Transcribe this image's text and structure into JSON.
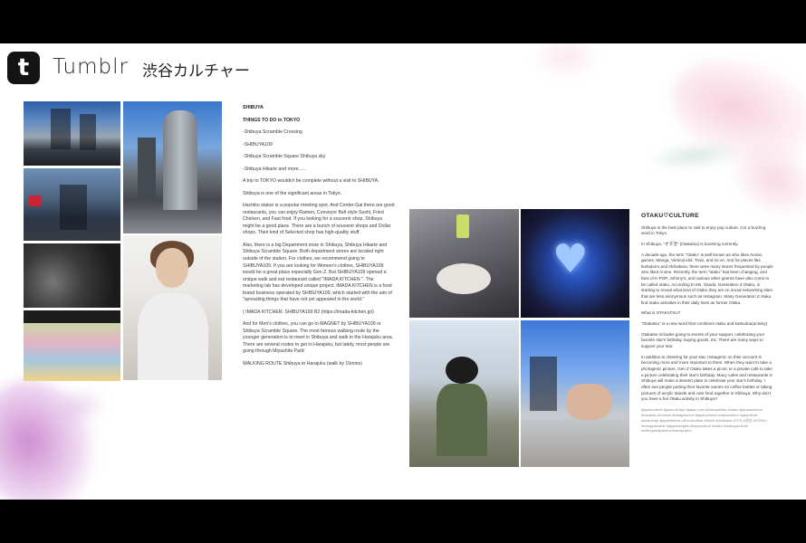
{
  "header": {
    "logo_letter": "t",
    "app_name": "Tumblr",
    "page_title": "渋谷カルチャー"
  },
  "photos": {
    "left": [
      {
        "name": "shibuya-crossing-photo",
        "icon": "photo-icon"
      },
      {
        "name": "shibuya-109-building-photo",
        "icon": "photo-icon"
      },
      {
        "name": "shibuya-street-photo",
        "icon": "photo-icon"
      },
      {
        "name": "portrait-photo",
        "icon": "photo-icon"
      },
      {
        "name": "shibuya-sky-night-photo",
        "icon": "photo-icon"
      },
      {
        "name": "comic-wall-photo",
        "icon": "photo-icon"
      }
    ],
    "right": [
      {
        "name": "cafe-dessert-photo",
        "icon": "photo-icon"
      },
      {
        "name": "blue-heart-photo",
        "icon": "photo-icon"
      },
      {
        "name": "child-photo",
        "icon": "photo-icon"
      },
      {
        "name": "street-hand-photo",
        "icon": "photo-icon"
      }
    ]
  },
  "left_article": {
    "title": "SHIBUYA",
    "subtitle": "THINGS TO DO in TOKYO",
    "list": [
      "-Shibuya Scramble Crossing",
      "-SHIBUYA109",
      "-Shibuya Scramble Square Shibuya sky",
      "-Shibuya Hikarie and more......"
    ],
    "p1": "A trip to TOKYO wouldn't be complete without a visit to SHIBUYA.",
    "p2": "Shibuya is one of the significant areas in Tokyo.",
    "p3": "Hachiko statue is a popular meeting spot. And Center-Gai there are good restaurants, you can enjoy Ramen, Conveyor Belt style Sushi, Fried Chicken, and Fast food. If you looking for a souvenir shop, Shibuya might be a good place. There are a bunch of souvenir shops and Dollar shops. Their kind of Selected shop has high-quality stuff.",
    "p4": "Also, there is a big Department store in Shibuya, Shibuya Hikarie and Shibuya Scramble Square. Both department stores are located right outside of the station. For clothes, we recommend going to SHIBUYA109. If you are looking for Women's clothes, SHIBUYA109 would be a great place especially Gen Z. But SHIBUYA109 opened a unique walk and eat restaurant called \"IMADA KITCHEN \". The marketing lab has developed unique project. IMADA KITCHEN is a food brand business operated by SHIBUYA109, which started with the aim of \"spreading things that have not yet appeared in the world.\"",
    "p5": "( IMADA KITCHEN: SHIBUYA109 B2 (https://imada-kitchen.jp/)",
    "p6": "And for Men's clothes, you can go to MAGNET by SHIBUYA109 or Shibuya Scramble Square. The most famous walking route by the younger generation is to meet in Shibuya and walk to the Harajuku area. There are several routes to get to Harajuku, but lately, most people are going through Miyashita Park!",
    "p7": "WALKING ROUTE Shibuya to Harajuku (walk by 15mins)"
  },
  "right_article": {
    "title": "OTAKU♡CULTURE",
    "p1": "Shibuya is the best place to visit to enjoy pop culture. It is a buzzing word in Tokyo.",
    "p2": "In Shibuya, \"オタ活\" (Otakatsu) is booming currently.",
    "p3": "A decade ago, the term \"Otaku\" is well known as who likes Anime, games, Manga, Vertical idol, Train, and so on. And for places like Ikebukuro and Akihabara, there were many stores frequented by people who liked Anime. Recently, the term \"otaku\" has been changing, and fans of K-POP, Johnny's, and various other genres have also come to be called otaku. According to Ms. Osada, Generation Z Otaku, is starting to reveal what kind of Otaku they are on social networking sites that are less anonymous such as Instagram. Many Generation Z otaku find otaku activities in their daily lives as former Otaku.",
    "p4": "What is OTAKATSU?",
    "p5": "\"Otakatsu\" is a new word that combines otaku and katsudou(activity)",
    "p6": "Otakatsu includes going to events of your support, celebrating your favorite star's birthday, buying goods, etc. There are many ways to support your star.",
    "p7": "In addition to cheering for your star, Instagenic on their account is becoming more and more important to them. When they want to take a photogenic picture, Gen Z Otaku takes a picnic or a private café to take a picture celebrating their star's birthday. Many cafes and restaurants in Shibuya will make a dessert plate to celebrate your star's birthday. I often see people putting their favorite names on coffee bottles or taking pictures of acrylic stands and cute food together in Shibuya. Why don't you have a fun Otaku activity in Shibuya?",
    "tags": "#japanculture #japan #tokyo #japan post #shibuyaMiss #otaku #japanesefood #harajuku #tourism #harajukufood #japanphotos #otakuculture #japanfood #otakumap #japanfashion #Foodculture #Kiss0 #Hokkaido #TCS #渋谷 #OTAKU #instagramable #japanesegirls #tokyoculture #otaku #shibuyaculture #shibuyashipanrevolutionproject"
  },
  "colors": {
    "slide_bg": "#ffffff",
    "letterbox": "#000000",
    "logo_bg": "#141414",
    "wash_pink": "#f6c8d6",
    "wash_purple": "#c478c8",
    "wash_green": "#bed7cd"
  }
}
